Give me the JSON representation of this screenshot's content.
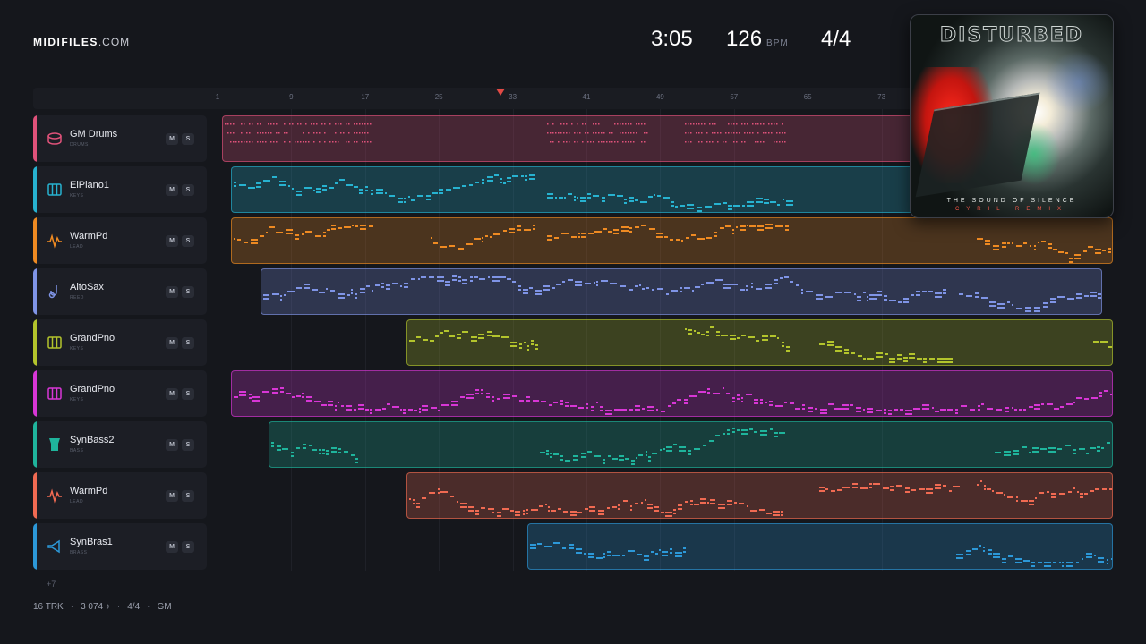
{
  "brand": {
    "bold": "MIDIFILES",
    "light": ".COM"
  },
  "header": {
    "time": "3:05",
    "bpm_value": "126",
    "bpm_unit": "BPM",
    "meter": "4/4"
  },
  "cover": {
    "band": "DISTURBED",
    "title": "THE SOUND OF SILENCE",
    "subtitle": "CYRIL REMIX"
  },
  "ruler": {
    "ticks": [
      "1",
      "9",
      "17",
      "25",
      "33",
      "41",
      "49",
      "57",
      "65",
      "73"
    ]
  },
  "tracks": [
    {
      "name": "GM Drums",
      "category": "DRUMS",
      "icon": "drum-icon",
      "color": "#e0527a",
      "mute": "M",
      "solo": "S"
    },
    {
      "name": "ElPiano1",
      "category": "KEYS",
      "icon": "piano-keys-icon",
      "color": "#27b2d0",
      "mute": "M",
      "solo": "S"
    },
    {
      "name": "WarmPd",
      "category": "LEAD",
      "icon": "waveform-icon",
      "color": "#ee8a22",
      "mute": "M",
      "solo": "S"
    },
    {
      "name": "AltoSax",
      "category": "REED",
      "icon": "sax-icon",
      "color": "#7f94e6",
      "mute": "M",
      "solo": "S"
    },
    {
      "name": "GrandPno",
      "category": "KEYS",
      "icon": "piano-keys-icon",
      "color": "#b3c42c",
      "mute": "M",
      "solo": "S"
    },
    {
      "name": "GrandPno",
      "category": "KEYS",
      "icon": "piano-keys-icon",
      "color": "#d836d6",
      "mute": "M",
      "solo": "S"
    },
    {
      "name": "SynBass2",
      "category": "BASS",
      "icon": "bass-amp-icon",
      "color": "#1fb49c",
      "mute": "M",
      "solo": "S"
    },
    {
      "name": "WarmPd",
      "category": "LEAD",
      "icon": "waveform-icon",
      "color": "#f06a52",
      "mute": "M",
      "solo": "S"
    },
    {
      "name": "SynBras1",
      "category": "BRASS",
      "icon": "brass-horn-icon",
      "color": "#2c98d8",
      "mute": "M",
      "solo": "S"
    }
  ],
  "more_tracks": "+7",
  "footer": {
    "tracks": "16 TRK",
    "notes": "3 074 ♪",
    "meter": "4/4",
    "standard": "GM"
  }
}
